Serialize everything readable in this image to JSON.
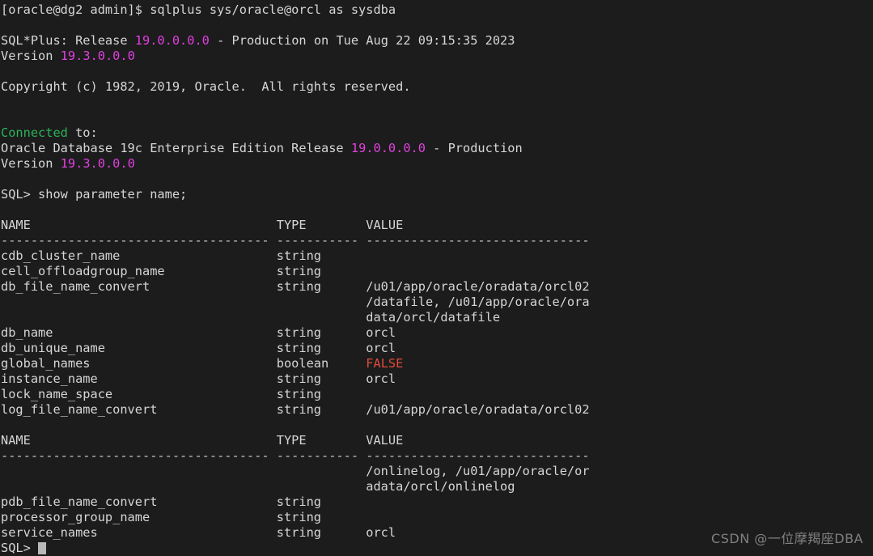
{
  "terminal": {
    "background_color": "#1c1c1c",
    "foreground_color": "#d6d6d6",
    "accent_magenta": "#e040e0",
    "accent_green": "#29b457",
    "accent_red": "#e04b3c",
    "cursor_color": "#b9b9b9",
    "shell_prompt": "[oracle@dg2 admin]$",
    "sql_prompt": "SQL>",
    "command_shell": "sqlplus sys/oracle@orcl as sysdba",
    "command_sql": "show parameter name;"
  },
  "lines": [
    {
      "id": "line-shell-command",
      "segments": [
        {
          "text": "[oracle@dg2 admin]$ sqlplus sys/oracle@orcl as sysdba",
          "color": "default"
        }
      ]
    },
    {
      "id": "line-blank-1",
      "segments": [
        {
          "text": "",
          "color": "default"
        }
      ]
    },
    {
      "id": "line-sqlplus-release",
      "segments": [
        {
          "text": "SQL*Plus: Release ",
          "color": "default"
        },
        {
          "text": "19.0.0.0.0",
          "color": "magenta"
        },
        {
          "text": " - Production on Tue Aug 22 09:15:35 2023",
          "color": "default"
        }
      ]
    },
    {
      "id": "line-sqlplus-version",
      "segments": [
        {
          "text": "Version ",
          "color": "default"
        },
        {
          "text": "19.3.0.0.0",
          "color": "magenta"
        }
      ]
    },
    {
      "id": "line-blank-2",
      "segments": [
        {
          "text": "",
          "color": "default"
        }
      ]
    },
    {
      "id": "line-copyright",
      "segments": [
        {
          "text": "Copyright (c) 1982, 2019, Oracle.  All rights reserved.",
          "color": "default"
        }
      ]
    },
    {
      "id": "line-blank-3",
      "segments": [
        {
          "text": "",
          "color": "default"
        }
      ]
    },
    {
      "id": "line-blank-4",
      "segments": [
        {
          "text": "",
          "color": "default"
        }
      ]
    },
    {
      "id": "line-connected-to",
      "segments": [
        {
          "text": "Connected",
          "color": "green"
        },
        {
          "text": " to:",
          "color": "default"
        }
      ]
    },
    {
      "id": "line-db-banner",
      "segments": [
        {
          "text": "Oracle Database 19c Enterprise Edition Release ",
          "color": "default"
        },
        {
          "text": "19.0.0.0.0",
          "color": "magenta"
        },
        {
          "text": " - Production",
          "color": "default"
        }
      ]
    },
    {
      "id": "line-db-version",
      "segments": [
        {
          "text": "Version ",
          "color": "default"
        },
        {
          "text": "19.3.0.0.0",
          "color": "magenta"
        }
      ]
    },
    {
      "id": "line-blank-5",
      "segments": [
        {
          "text": "",
          "color": "default"
        }
      ]
    },
    {
      "id": "line-sql-command",
      "segments": [
        {
          "text": "SQL> show parameter name;",
          "color": "default"
        }
      ]
    },
    {
      "id": "line-blank-6",
      "segments": [
        {
          "text": "",
          "color": "default"
        }
      ]
    },
    {
      "id": "line-header-1",
      "segments": [
        {
          "text": "NAME                                 TYPE        VALUE",
          "color": "header"
        }
      ]
    },
    {
      "id": "line-rule-1",
      "segments": [
        {
          "text": "------------------------------------ ----------- ------------------------------",
          "color": "dash"
        }
      ]
    },
    {
      "id": "line-cdb-cluster-name",
      "segments": [
        {
          "text": "cdb_cluster_name                     string",
          "color": "default"
        }
      ]
    },
    {
      "id": "line-cell-offloadgroup-name",
      "segments": [
        {
          "text": "cell_offloadgroup_name               string",
          "color": "default"
        }
      ]
    },
    {
      "id": "line-db-file-name-convert",
      "segments": [
        {
          "text": "db_file_name_convert                 string      /u01/app/oracle/oradata/orcl02",
          "color": "default"
        }
      ]
    },
    {
      "id": "line-db-file-name-convert-c2",
      "segments": [
        {
          "text": "                                                 /datafile, /u01/app/oracle/ora",
          "color": "default"
        }
      ]
    },
    {
      "id": "line-db-file-name-convert-c3",
      "segments": [
        {
          "text": "                                                 data/orcl/datafile",
          "color": "default"
        }
      ]
    },
    {
      "id": "line-db-name",
      "segments": [
        {
          "text": "db_name                              string      orcl",
          "color": "default"
        }
      ]
    },
    {
      "id": "line-db-unique-name",
      "segments": [
        {
          "text": "db_unique_name                       string      orcl",
          "color": "default"
        }
      ]
    },
    {
      "id": "line-global-names",
      "segments": [
        {
          "text": "global_names                         boolean     ",
          "color": "default"
        },
        {
          "text": "FALSE",
          "color": "red"
        }
      ]
    },
    {
      "id": "line-instance-name",
      "segments": [
        {
          "text": "instance_name                        string      orcl",
          "color": "default"
        }
      ]
    },
    {
      "id": "line-lock-name-space",
      "segments": [
        {
          "text": "lock_name_space                      string",
          "color": "default"
        }
      ]
    },
    {
      "id": "line-log-file-name-convert",
      "segments": [
        {
          "text": "log_file_name_convert                string      /u01/app/oracle/oradata/orcl02",
          "color": "default"
        }
      ]
    },
    {
      "id": "line-blank-7",
      "segments": [
        {
          "text": "",
          "color": "default"
        }
      ]
    },
    {
      "id": "line-header-2",
      "segments": [
        {
          "text": "NAME                                 TYPE        VALUE",
          "color": "header"
        }
      ]
    },
    {
      "id": "line-rule-2",
      "segments": [
        {
          "text": "------------------------------------ ----------- ------------------------------",
          "color": "dash"
        }
      ]
    },
    {
      "id": "line-log-file-convert-c2",
      "segments": [
        {
          "text": "                                                 /onlinelog, /u01/app/oracle/or",
          "color": "default"
        }
      ]
    },
    {
      "id": "line-log-file-convert-c3",
      "segments": [
        {
          "text": "                                                 adata/orcl/onlinelog",
          "color": "default"
        }
      ]
    },
    {
      "id": "line-pdb-file-name-convert",
      "segments": [
        {
          "text": "pdb_file_name_convert                string",
          "color": "default"
        }
      ]
    },
    {
      "id": "line-processor-group-name",
      "segments": [
        {
          "text": "processor_group_name                 string",
          "color": "default"
        }
      ]
    },
    {
      "id": "line-service-names",
      "segments": [
        {
          "text": "service_names                        string      orcl",
          "color": "default"
        }
      ]
    },
    {
      "id": "line-prompt-cursor",
      "segments": [
        {
          "text": "SQL> ",
          "color": "default"
        }
      ],
      "cursor": true
    }
  ],
  "parameters_table": {
    "columns": [
      "NAME",
      "TYPE",
      "VALUE"
    ],
    "rows": [
      {
        "name": "cdb_cluster_name",
        "type": "string",
        "value": ""
      },
      {
        "name": "cell_offloadgroup_name",
        "type": "string",
        "value": ""
      },
      {
        "name": "db_file_name_convert",
        "type": "string",
        "value": "/u01/app/oracle/oradata/orcl02/datafile, /u01/app/oracle/oradata/orcl/datafile"
      },
      {
        "name": "db_name",
        "type": "string",
        "value": "orcl"
      },
      {
        "name": "db_unique_name",
        "type": "string",
        "value": "orcl"
      },
      {
        "name": "global_names",
        "type": "boolean",
        "value": "FALSE"
      },
      {
        "name": "instance_name",
        "type": "string",
        "value": "orcl"
      },
      {
        "name": "lock_name_space",
        "type": "string",
        "value": ""
      },
      {
        "name": "log_file_name_convert",
        "type": "string",
        "value": "/u01/app/oracle/oradata/orcl02/onlinelog, /u01/app/oracle/oradata/orcl/onlinelog"
      },
      {
        "name": "pdb_file_name_convert",
        "type": "string",
        "value": ""
      },
      {
        "name": "processor_group_name",
        "type": "string",
        "value": ""
      },
      {
        "name": "service_names",
        "type": "string",
        "value": "orcl"
      }
    ]
  },
  "watermark": {
    "text": "CSDN @一位摩羯座DBA"
  }
}
